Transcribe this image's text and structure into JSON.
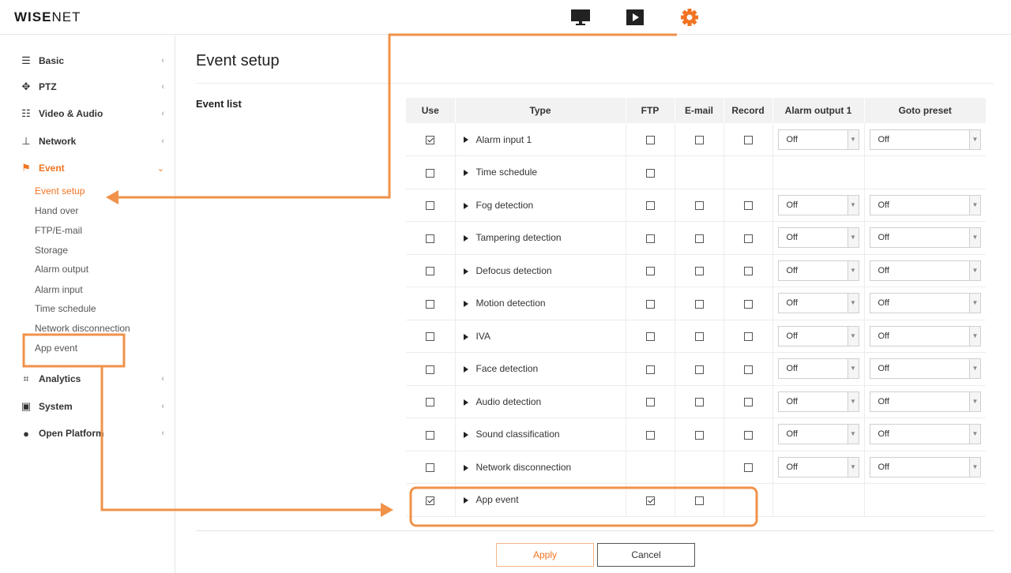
{
  "header": {
    "logo_bold": "WISE",
    "logo_thin": "NET",
    "icons": [
      "monitor-icon",
      "play-icon",
      "gear-icon"
    ]
  },
  "sidebar": {
    "items": [
      {
        "label": "Basic",
        "icon": "list-icon"
      },
      {
        "label": "PTZ",
        "icon": "ptz-icon"
      },
      {
        "label": "Video & Audio",
        "icon": "sliders-icon"
      },
      {
        "label": "Network",
        "icon": "network-icon"
      },
      {
        "label": "Event",
        "icon": "event-icon",
        "active": true
      },
      {
        "label": "Analytics",
        "icon": "analytics-icon"
      },
      {
        "label": "System",
        "icon": "system-icon"
      },
      {
        "label": "Open Platform",
        "icon": "open-platform-icon"
      }
    ],
    "event_sub": [
      "Event setup",
      "Hand over",
      "FTP/E-mail",
      "Storage",
      "Alarm output",
      "Alarm input",
      "Time schedule",
      "Network disconnection",
      "App event"
    ]
  },
  "main": {
    "title": "Event setup",
    "section": "Event list",
    "columns": [
      "Use",
      "Type",
      "FTP",
      "E-mail",
      "Record",
      "Alarm output 1",
      "Goto preset"
    ],
    "rows": [
      {
        "type": "Alarm input 1",
        "use": true,
        "ftp": false,
        "email": false,
        "record": false,
        "alarm": "Off",
        "preset": "Off"
      },
      {
        "type": "Time schedule",
        "use": false,
        "ftp": false
      },
      {
        "type": "Fog detection",
        "use": false,
        "ftp": false,
        "email": false,
        "record": false,
        "alarm": "Off",
        "preset": "Off"
      },
      {
        "type": "Tampering detection",
        "use": false,
        "ftp": false,
        "email": false,
        "record": false,
        "alarm": "Off",
        "preset": "Off"
      },
      {
        "type": "Defocus detection",
        "use": false,
        "ftp": false,
        "email": false,
        "record": false,
        "alarm": "Off",
        "preset": "Off"
      },
      {
        "type": "Motion detection",
        "use": false,
        "ftp": false,
        "email": false,
        "record": false,
        "alarm": "Off",
        "preset": "Off"
      },
      {
        "type": "IVA",
        "use": false,
        "ftp": false,
        "email": false,
        "record": false,
        "alarm": "Off",
        "preset": "Off"
      },
      {
        "type": "Face detection",
        "use": false,
        "ftp": false,
        "email": false,
        "record": false,
        "alarm": "Off",
        "preset": "Off"
      },
      {
        "type": "Audio detection",
        "use": false,
        "ftp": false,
        "email": false,
        "record": false,
        "alarm": "Off",
        "preset": "Off"
      },
      {
        "type": "Sound classification",
        "use": false,
        "ftp": false,
        "email": false,
        "record": false,
        "alarm": "Off",
        "preset": "Off"
      },
      {
        "type": "Network disconnection",
        "use": false,
        "record": false,
        "alarm": "Off",
        "preset": "Off"
      },
      {
        "type": "App event",
        "use": true,
        "ftp": true,
        "email": false
      }
    ],
    "apply_label": "Apply",
    "cancel_label": "Cancel"
  },
  "colors": {
    "accent": "#f37321",
    "annotation": "#f0924a"
  }
}
